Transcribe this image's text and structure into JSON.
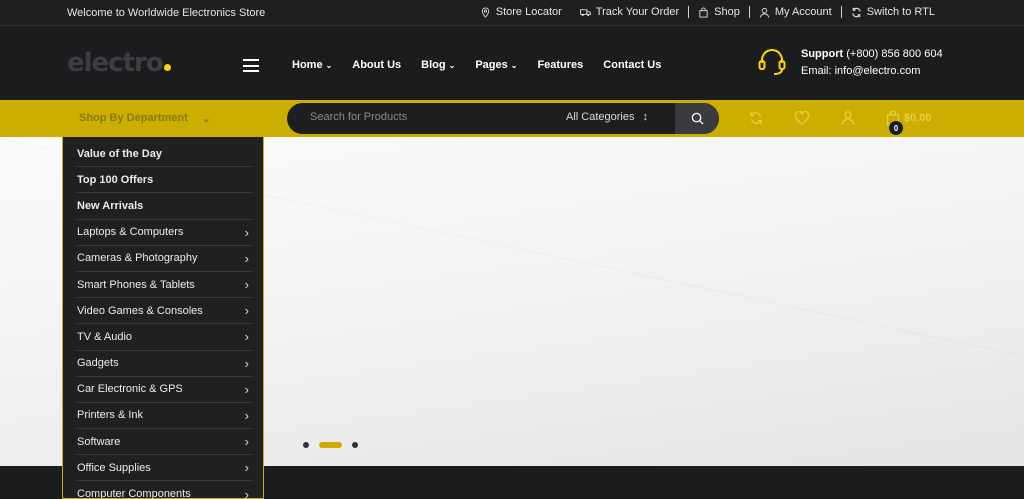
{
  "topbar": {
    "welcome": "Welcome to Worldwide Electronics Store",
    "links": [
      {
        "label": "Store Locator",
        "icon": "map-pin-icon"
      },
      {
        "label": "Track Your Order",
        "icon": "truck-icon"
      },
      {
        "label": "Shop",
        "icon": "bag-icon"
      },
      {
        "label": "My Account",
        "icon": "user-icon"
      },
      {
        "label": "Switch to RTL",
        "icon": "sync-icon"
      }
    ]
  },
  "header": {
    "logo": "electro",
    "nav": [
      {
        "label": "Home",
        "dropdown": true
      },
      {
        "label": "About Us",
        "dropdown": false
      },
      {
        "label": "Blog",
        "dropdown": true
      },
      {
        "label": "Pages",
        "dropdown": true
      },
      {
        "label": "Features",
        "dropdown": false
      },
      {
        "label": "Contact Us",
        "dropdown": false
      }
    ],
    "support_label": "Support",
    "support_phone": "(+800) 856 800 604",
    "support_email": "Email: info@electro.com"
  },
  "navbar": {
    "department_label": "Shop By Department",
    "search_placeholder": "Search for Products",
    "category_selected": "All Categories",
    "cart_total": "$0.00",
    "cart_count": "0"
  },
  "departments": [
    {
      "label": "Value of the Day",
      "bold": true,
      "arrow": false
    },
    {
      "label": "Top 100 Offers",
      "bold": true,
      "arrow": false
    },
    {
      "label": "New Arrivals",
      "bold": true,
      "arrow": false
    },
    {
      "label": "Laptops & Computers",
      "bold": false,
      "arrow": true
    },
    {
      "label": "Cameras & Photography",
      "bold": false,
      "arrow": true
    },
    {
      "label": "Smart Phones & Tablets",
      "bold": false,
      "arrow": true
    },
    {
      "label": "Video Games & Consoles",
      "bold": false,
      "arrow": true
    },
    {
      "label": "TV & Audio",
      "bold": false,
      "arrow": true
    },
    {
      "label": "Gadgets",
      "bold": false,
      "arrow": true
    },
    {
      "label": "Car Electronic & GPS",
      "bold": false,
      "arrow": true
    },
    {
      "label": "Printers & Ink",
      "bold": false,
      "arrow": true
    },
    {
      "label": "Software",
      "bold": false,
      "arrow": true
    },
    {
      "label": "Office Supplies",
      "bold": false,
      "arrow": true
    },
    {
      "label": "Computer Components",
      "bold": false,
      "arrow": true
    }
  ],
  "slider": {
    "slides": 3,
    "active": 2
  },
  "colors": {
    "accent": "#cbae00",
    "dark": "#1b1c1e"
  }
}
